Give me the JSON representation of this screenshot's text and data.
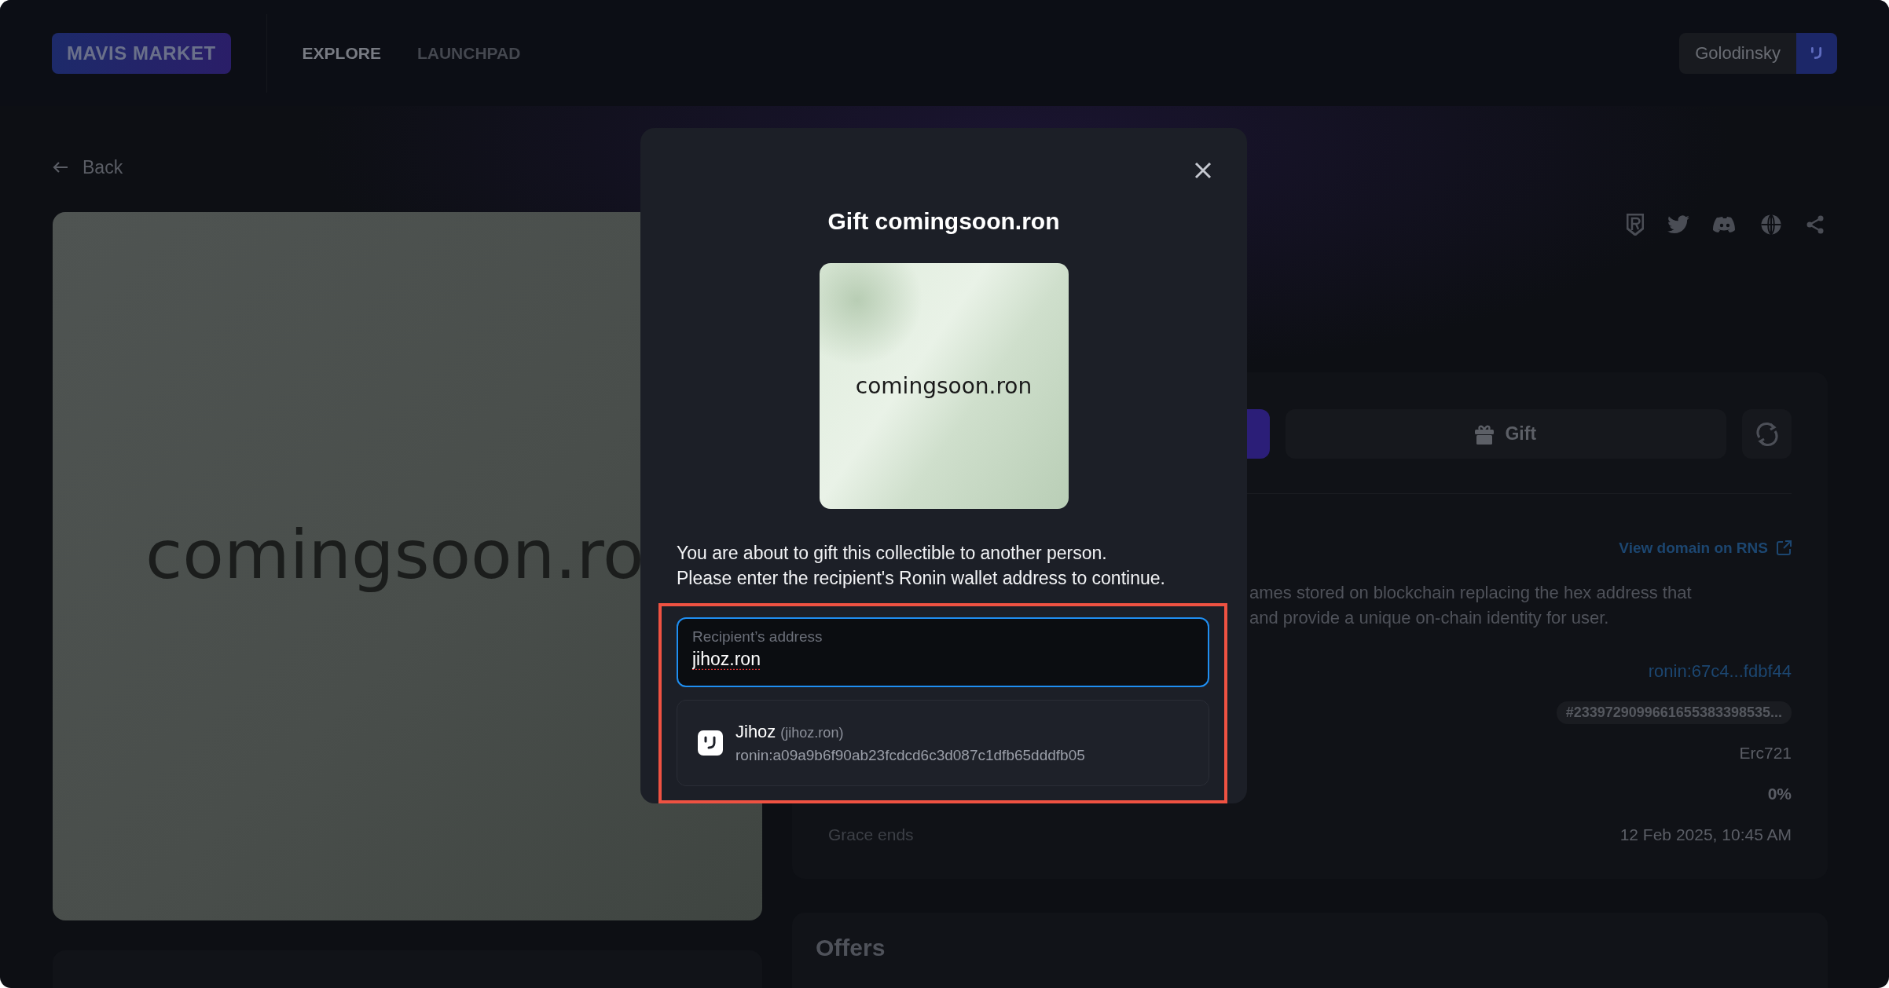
{
  "header": {
    "logo": "MAVIS MARKET",
    "nav": [
      {
        "label": "EXPLORE",
        "selected": true
      },
      {
        "label": "LAUNCHPAD",
        "selected": false
      }
    ],
    "user": "Golodinsky"
  },
  "back": "Back",
  "preview": {
    "text": "comingsoon.ro"
  },
  "actions": {
    "gift": "Gift"
  },
  "details": {
    "link": "View domain on RNS",
    "description": [
      "ames stored on blockchain replacing the hex address that",
      "and provide a unique on-chain identity for user."
    ],
    "rows": [
      {
        "kind": "link",
        "value": "ronin:67c4...fdbf44"
      },
      {
        "kind": "tag",
        "value": "#2339729099661655383398535..."
      },
      {
        "kind": "plain",
        "value": "Erc721"
      },
      {
        "kind": "bold",
        "value": "0%"
      },
      {
        "kind": "plain",
        "label": "Grace ends",
        "value": "12 Feb 2025, 10:45 AM"
      }
    ]
  },
  "offers": {
    "title": "Offers"
  },
  "modal": {
    "title": "Gift comingsoon.ron",
    "image_text": "comingsoon.ron",
    "message": [
      "You are about to gift this collectible to another person.",
      "Please enter the recipient's Ronin wallet address to continue."
    ],
    "field": {
      "label": "Recipient’s address",
      "value": "jihoz.ron"
    },
    "suggestion": {
      "name": "Jihoz",
      "handle": "(jihoz.ron)",
      "address": "ronin:a09a9b6f90ab23fcdcd6c3d087c1dfb65dddfb05"
    }
  }
}
